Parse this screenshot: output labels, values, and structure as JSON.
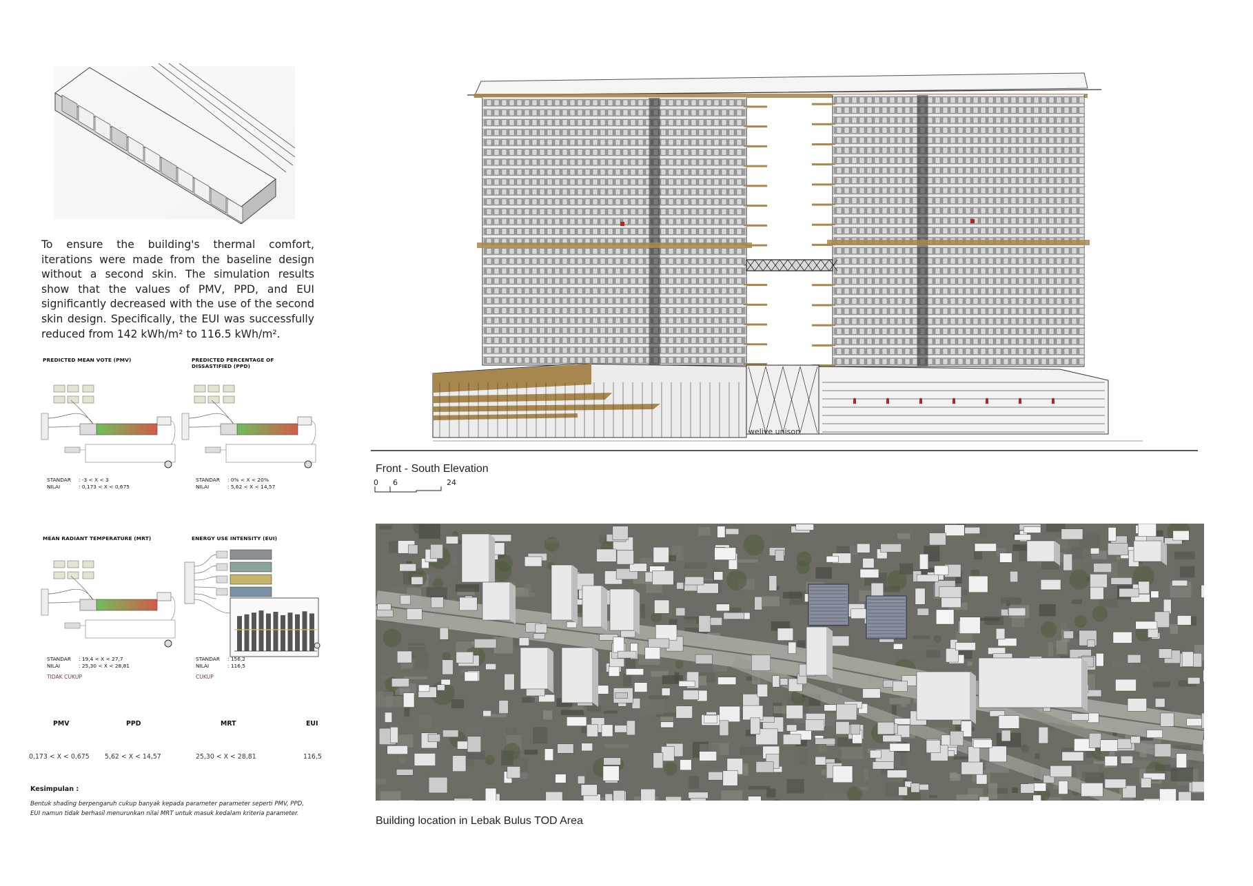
{
  "intro_text": "To ensure the building's thermal comfort, iterations were made from the baseline design without a second skin. The simulation results show that the values of PMV, PPD, and EUI significantly decreased with the use of the second skin design. Specifically, the EUI was successfully reduced from 142 kWh/m² to 116.5 kWh/m².",
  "panels": [
    {
      "title": "PREDICTED MEAN VOTE (PMV)",
      "standar_label": "STANDAR",
      "standar_value": ": -3 < X < 3",
      "nilai_label": "NILAI",
      "nilai_value": ": 0,173 < X < 0,675",
      "verdict": ""
    },
    {
      "title": "PREDICTED PERCENTAGE OF DISSASTIFIED (PPD)",
      "standar_label": "STANDAR",
      "standar_value": ": 0% < X < 20%",
      "nilai_label": "NILAI",
      "nilai_value": ": 5,62 < X < 14,57",
      "verdict": ""
    },
    {
      "title": "MEAN RADIANT TEMPERATURE (MRT)",
      "standar_label": "STANDAR",
      "standar_value": ": 19,4 < X < 27,7",
      "nilai_label": "NILAI",
      "nilai_value": ": 25,30 < X < 28,81",
      "verdict": "TIDAK CUKUP"
    },
    {
      "title": "ENERGY USE INTENSITY (EUI)",
      "standar_label": "STANDAR",
      "standar_value": ": 156,2",
      "nilai_label": "NILAI",
      "nilai_value": ": 116,5",
      "verdict": "CUKUP"
    }
  ],
  "eui_bars": [
    0.82,
    0.86,
    0.9,
    0.95,
    0.88,
    0.92,
    0.84,
    0.9,
    0.86,
    0.93,
    0.88
  ],
  "summary": {
    "headers": [
      "PMV",
      "PPD",
      "MRT",
      "EUI"
    ],
    "values": [
      "0,173 < X < 0,675",
      "5,62 < X < 14,57",
      "25,30 < X < 28,81",
      "116,5"
    ]
  },
  "conclusion": {
    "title": "Kesimpulan :",
    "body": "Bentuk shading berpengaruh cukup banyak kepada parameter parameter seperti PMV, PPD, EUI namun tidak berhasil menurunkan nilai MRT untuk masuk kedalam kriteria parameter."
  },
  "elevation": {
    "caption": "Front - South Elevation",
    "scale_ticks": [
      "0",
      "6",
      "24"
    ],
    "signage": "welive unison"
  },
  "map": {
    "caption": "Building location in Lebak Bulus TOD Area"
  },
  "colors": {
    "bronze": "#9a7a4a",
    "facade_gray": "#8c8c8c",
    "accent_red": "#b3261e",
    "verdict": "#7a3b3b"
  }
}
